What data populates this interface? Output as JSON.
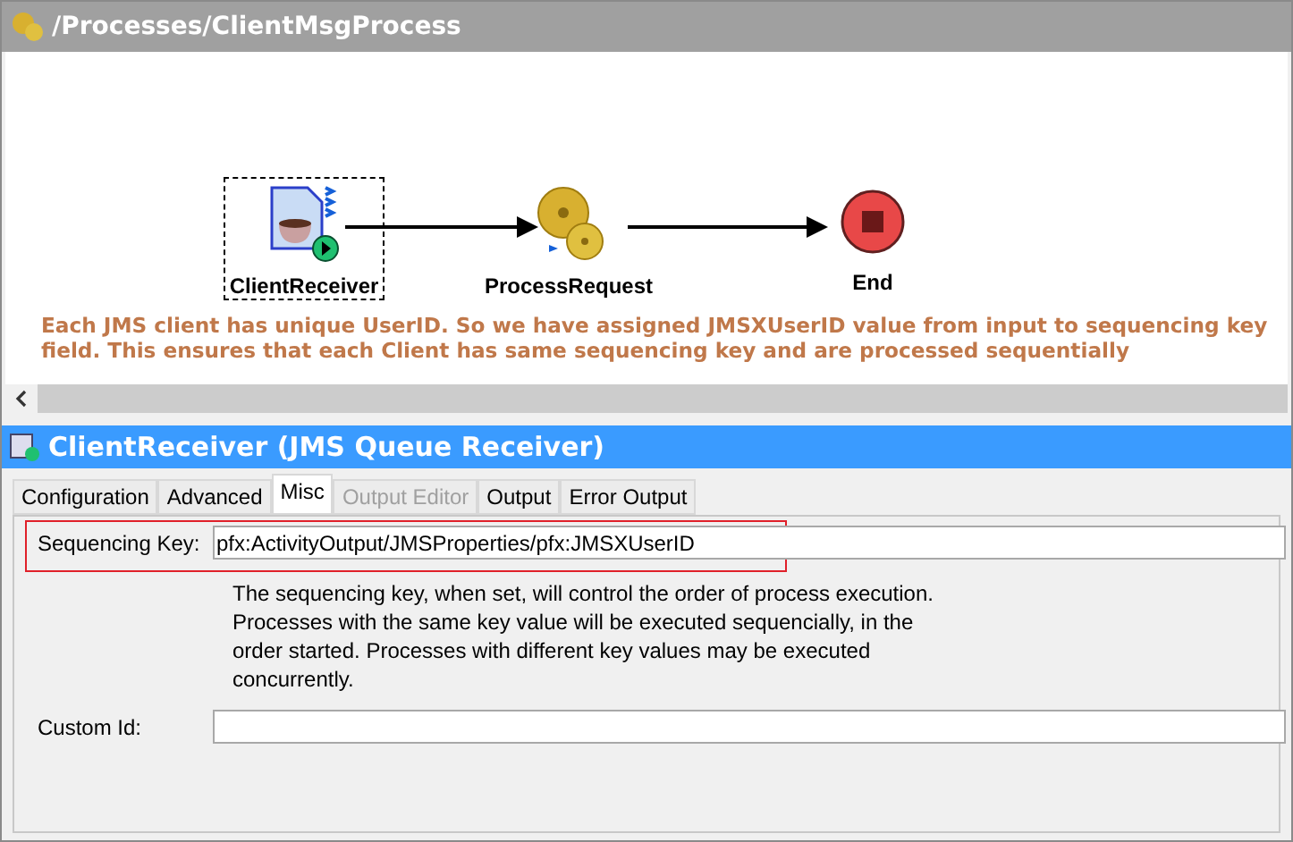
{
  "window": {
    "title": "/Processes/ClientMsgProcess"
  },
  "diagram": {
    "nodes": [
      {
        "kind": "receiver",
        "label": "ClientReceiver",
        "selected": true
      },
      {
        "kind": "process",
        "label": "ProcessRequest",
        "selected": false
      },
      {
        "kind": "end",
        "label": "End",
        "selected": false
      }
    ],
    "note": "Each JMS client has unique UserID. So we have assigned JMSXUserID value from input to sequencing key field. This ensures that each Client has same sequencing key and are processed sequentially"
  },
  "panel": {
    "title": "ClientReceiver (JMS Queue Receiver)",
    "tabs": [
      {
        "label": "Configuration",
        "selected": false,
        "disabled": false
      },
      {
        "label": "Advanced",
        "selected": false,
        "disabled": false
      },
      {
        "label": "Misc",
        "selected": true,
        "disabled": false
      },
      {
        "label": "Output Editor",
        "selected": false,
        "disabled": true
      },
      {
        "label": "Output",
        "selected": false,
        "disabled": false
      },
      {
        "label": "Error Output",
        "selected": false,
        "disabled": false
      }
    ],
    "fields": [
      {
        "label": "Sequencing Key:",
        "value": "pfx:ActivityOutput/JMSProperties/pfx:JMSXUserID",
        "highlighted": true,
        "help": "The sequencing key, when set, will control the order of process execution. Processes with the same key value will be executed sequencially, in the order started. Processes with different key values may be executed concurrently."
      },
      {
        "label": "Custom Id:",
        "highlighted": false
      }
    ]
  }
}
